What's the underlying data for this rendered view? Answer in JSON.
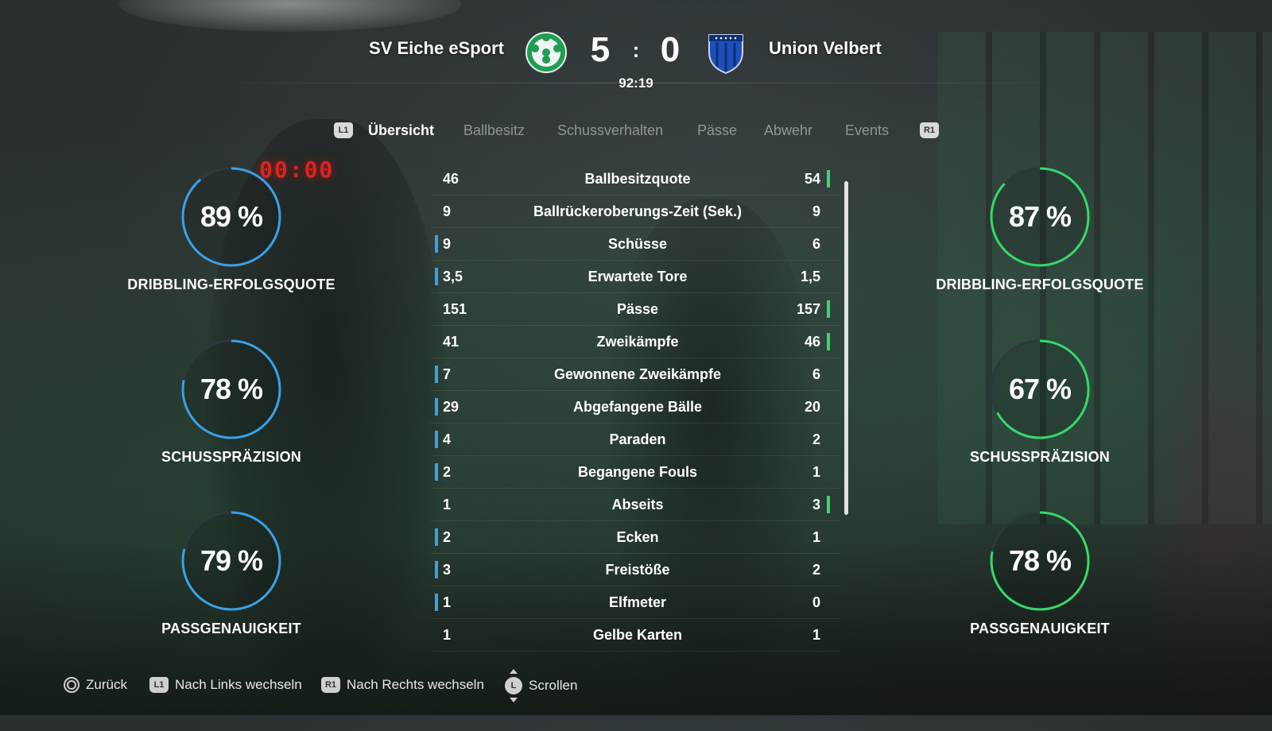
{
  "match": {
    "home_team": "SV Eiche eSport",
    "away_team": "Union Velbert",
    "home_score": "5",
    "separator": ":",
    "away_score": "0",
    "time": "92:19"
  },
  "background": {
    "stadium_clock": "00:00"
  },
  "tabs": {
    "left_shoulder": "L1",
    "right_shoulder": "R1",
    "items": [
      "Übersicht",
      "Ballbesitz",
      "Schussverhalten",
      "Pässe",
      "Abwehr",
      "Events"
    ],
    "active_index": 0
  },
  "stats": [
    {
      "label": "Ballbesitzquote",
      "home": "46",
      "away": "54",
      "leader": "away"
    },
    {
      "label": "Ballrückeroberungs-Zeit (Sek.)",
      "home": "9",
      "away": "9",
      "leader": "none"
    },
    {
      "label": "Schüsse",
      "home": "9",
      "away": "6",
      "leader": "home"
    },
    {
      "label": "Erwartete Tore",
      "home": "3,5",
      "away": "1,5",
      "leader": "home"
    },
    {
      "label": "Pässe",
      "home": "151",
      "away": "157",
      "leader": "away"
    },
    {
      "label": "Zweikämpfe",
      "home": "41",
      "away": "46",
      "leader": "away"
    },
    {
      "label": "Gewonnene Zweikämpfe",
      "home": "7",
      "away": "6",
      "leader": "home"
    },
    {
      "label": "Abgefangene Bälle",
      "home": "29",
      "away": "20",
      "leader": "home"
    },
    {
      "label": "Paraden",
      "home": "4",
      "away": "2",
      "leader": "home"
    },
    {
      "label": "Begangene Fouls",
      "home": "2",
      "away": "1",
      "leader": "home"
    },
    {
      "label": "Abseits",
      "home": "1",
      "away": "3",
      "leader": "away"
    },
    {
      "label": "Ecken",
      "home": "2",
      "away": "1",
      "leader": "home"
    },
    {
      "label": "Freistöße",
      "home": "3",
      "away": "2",
      "leader": "home"
    },
    {
      "label": "Elfmeter",
      "home": "1",
      "away": "0",
      "leader": "home"
    },
    {
      "label": "Gelbe Karten",
      "home": "1",
      "away": "1",
      "leader": "none"
    }
  ],
  "rings": {
    "home": [
      {
        "label": "DRIBBLING-ERFOLGSQUOTE",
        "value": 89,
        "text": "89 %"
      },
      {
        "label": "SCHUSSPRÄZISION",
        "value": 78,
        "text": "78 %"
      },
      {
        "label": "PASSGENAUIGKEIT",
        "value": 79,
        "text": "79 %"
      }
    ],
    "away": [
      {
        "label": "DRIBBLING-ERFOLGSQUOTE",
        "value": 87,
        "text": "87 %"
      },
      {
        "label": "SCHUSSPRÄZISION",
        "value": 67,
        "text": "67 %"
      },
      {
        "label": "PASSGENAUIGKEIT",
        "value": 78,
        "text": "78 %"
      }
    ]
  },
  "colors": {
    "home_accent": "#3aa1e6",
    "away_accent": "#36d96c",
    "ring_track": "#2a3a3e"
  },
  "footer": {
    "back": "Zurück",
    "prev_key": "L1",
    "prev": "Nach Links wechseln",
    "next_key": "R1",
    "next": "Nach Rechts wechseln",
    "scroll_key": "L",
    "scroll": "Scrollen"
  }
}
